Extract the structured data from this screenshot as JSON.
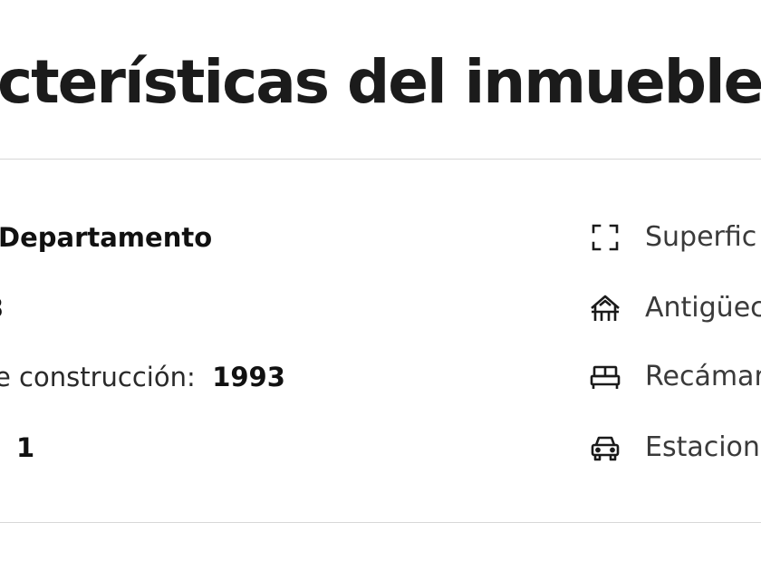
{
  "section": {
    "title": "cterísticas del inmueble"
  },
  "left": {
    "type_value": "Departamento",
    "number_value": "3",
    "construction_label": "e construcción:",
    "construction_value": "1993",
    "count_value": "1"
  },
  "right": {
    "items": [
      {
        "icon": "expand-frame-icon",
        "label": "Superfic"
      },
      {
        "icon": "house-age-icon",
        "label": "Antigüec"
      },
      {
        "icon": "bed-icon",
        "label": "Recámar"
      },
      {
        "icon": "car-icon",
        "label": "Estacion"
      }
    ]
  }
}
